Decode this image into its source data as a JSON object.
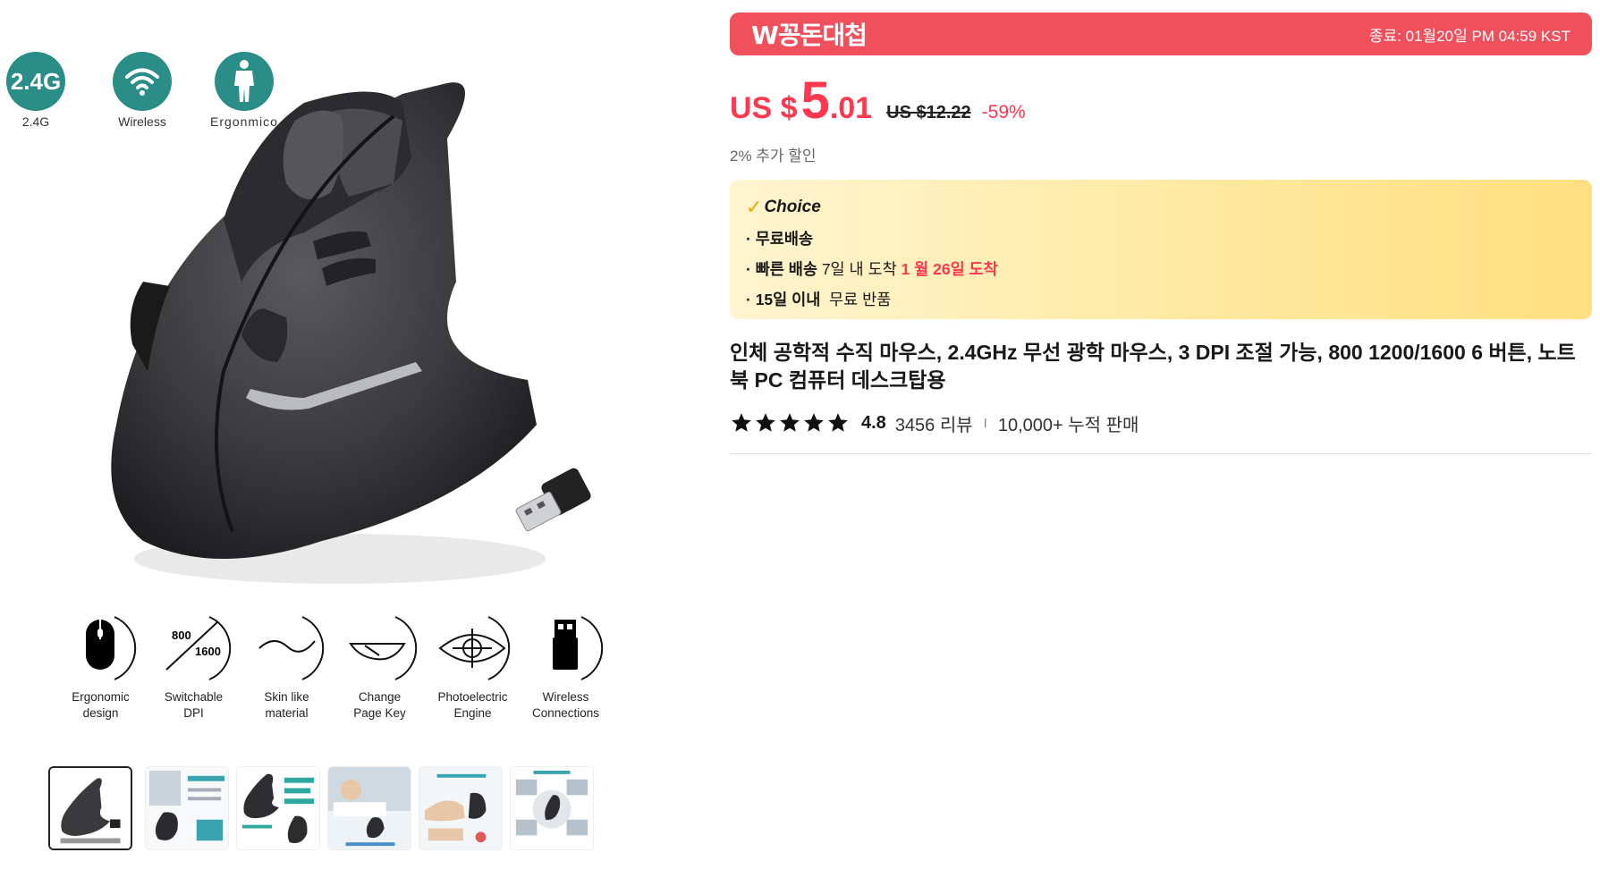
{
  "gallery": {
    "badges": [
      {
        "icon": "2.4g-badge-icon",
        "text": "2.4G",
        "caption": "2.4G"
      },
      {
        "icon": "wireless-badge-icon",
        "text": "",
        "caption": "Wireless"
      },
      {
        "icon": "ergonomic-person-badge-icon",
        "text": "",
        "caption": "Ergonmico"
      }
    ],
    "features": [
      {
        "icon": "mouse-icon",
        "label": "Ergonomic\ndesign"
      },
      {
        "icon": "dpi-icon",
        "label": "Switchable\nDPI",
        "dpi_low": "800",
        "dpi_high": "1600"
      },
      {
        "icon": "wave-icon",
        "label": "Skin like\nmaterial"
      },
      {
        "icon": "page-key-icon",
        "label": "Change\nPage Key"
      },
      {
        "icon": "eye-target-icon",
        "label": "Photoelectric\nEngine"
      },
      {
        "icon": "usb-icon",
        "label": "Wireless\nConnections"
      }
    ],
    "thumbnail_count": 6,
    "active_thumbnail": 1
  },
  "promo": {
    "title": "W꽁돈대첩",
    "end_text": "종료: 01월20일 PM 04:59 KST"
  },
  "price": {
    "currency": "US $",
    "integer": "5",
    "decimal": ".01",
    "original": "US $12.22",
    "discount": "-59%",
    "extra_discount": "2% 추가 할인"
  },
  "choice": {
    "label": "Choice",
    "free_shipping": "· 무료배송",
    "fast_label": "· 빠른 배송",
    "fast_text": " 7일 내 도착 ",
    "fast_date": "1 월 26일 도착",
    "return_label": "· 15일 이내",
    "return_text": "  무료 반품"
  },
  "product": {
    "title": "인체 공학적 수직 마우스, 2.4GHz 무선 광학 마우스, 3 DPI 조절 가능, 800 1200/1600 6 버튼, 노트북 PC 컴퓨터 데스크탑용",
    "rating": "4.8",
    "stars": 5,
    "reviews": "3456 리뷰",
    "separator": "I",
    "sold": "10,000+ 누적 판매"
  },
  "colors": {
    "promo_bg": "#f0505c",
    "price_red": "#fd384f",
    "badge_teal": "#2a8d87",
    "choice_check": "#e7a800"
  }
}
